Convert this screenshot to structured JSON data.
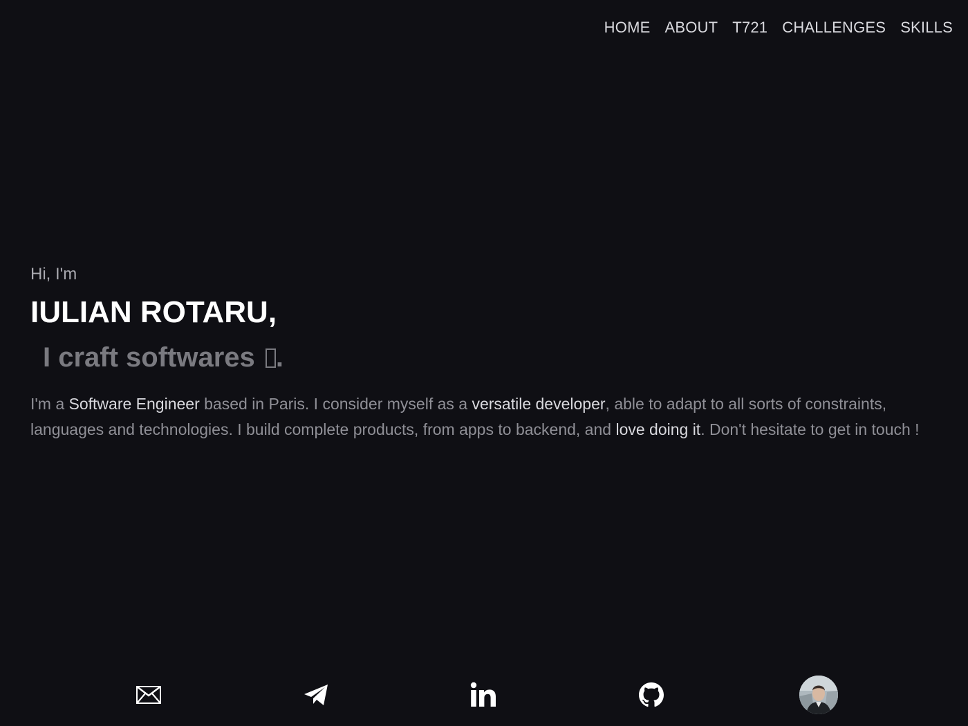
{
  "nav": {
    "items": [
      {
        "label": "HOME"
      },
      {
        "label": "ABOUT"
      },
      {
        "label": "T721"
      },
      {
        "label": "CHALLENGES"
      },
      {
        "label": "SKILLS"
      }
    ]
  },
  "hero": {
    "greeting": "Hi, I'm",
    "name": "IULIAN ROTARU,",
    "tagline": "I craft softwares",
    "tagline_end": ".",
    "bio": {
      "p1": "I'm a ",
      "b1": "Software Engineer",
      "p2": " based in Paris. I consider myself as a ",
      "b2": "versatile developer",
      "p3": ", able to adapt to all sorts of constraints, languages and technologies. I build complete products, from apps to backend, and ",
      "b3": "love doing it",
      "p4": ". Don't hesitate to get in touch !"
    }
  },
  "contacts": [
    {
      "icon": "mail-icon"
    },
    {
      "icon": "telegram-icon"
    },
    {
      "icon": "linkedin-icon"
    },
    {
      "icon": "github-icon"
    },
    {
      "icon": "avatar"
    }
  ],
  "colors": {
    "background": "#0f0f14",
    "heading": "#ffffff",
    "muted": "#8f8f96",
    "accent_text": "#d9d9de"
  }
}
